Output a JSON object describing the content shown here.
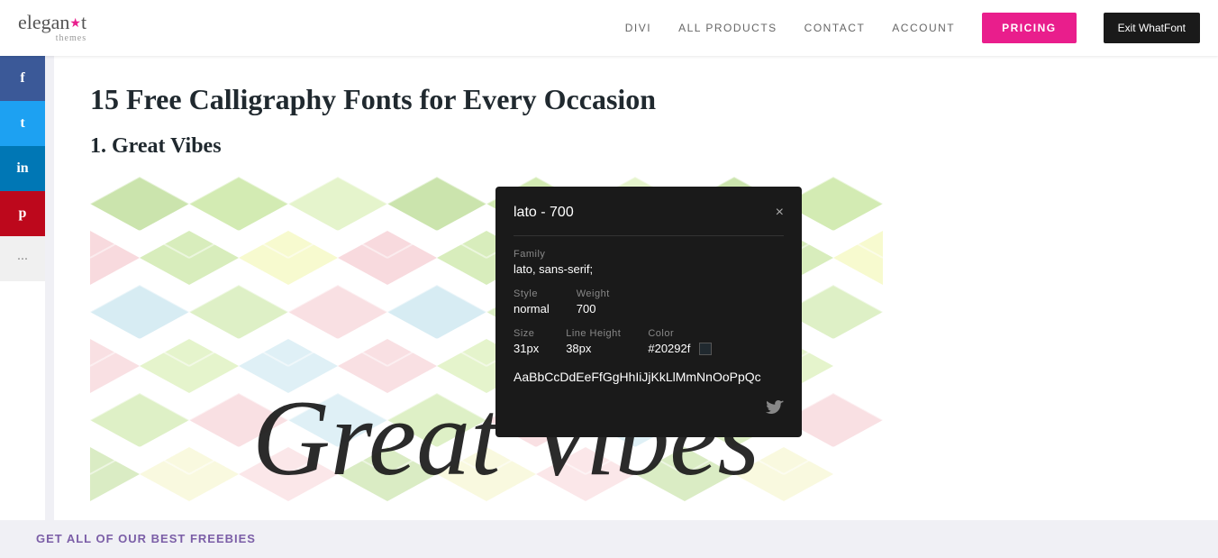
{
  "header": {
    "logo": {
      "main": "elegant",
      "star": "★",
      "sub": "themes"
    },
    "nav": {
      "items": [
        "DIVI",
        "ALL PRODUCTS",
        "CONTACT",
        "ACCOUNT"
      ],
      "pricing_label": "PRICING",
      "exit_whatfont_label": "Exit WhatFont"
    }
  },
  "article": {
    "title": "15 Free Calligraphy Fonts for Every Occasion",
    "section1_title": "1. Great Vibes",
    "font_image_text": "Great Vibes"
  },
  "whatfont_popup": {
    "title": "lato - 700",
    "close_label": "×",
    "family_label": "Family",
    "family_value": "lato, sans-serif;",
    "style_label": "Style",
    "style_value": "normal",
    "weight_label": "Weight",
    "weight_value": "700",
    "size_label": "Size",
    "size_value": "31px",
    "lineheight_label": "Line Height",
    "lineheight_value": "38px",
    "color_label": "Color",
    "color_value": "#20292f",
    "color_hex": "#20292f",
    "alphabet": "AaBbCcDdEeFfGgHhIiJjKkLlMmNnOoPpQc"
  },
  "social": {
    "items": [
      {
        "name": "facebook",
        "icon": "f"
      },
      {
        "name": "twitter",
        "icon": "t"
      },
      {
        "name": "linkedin",
        "icon": "in"
      },
      {
        "name": "pinterest",
        "icon": "p"
      },
      {
        "name": "more",
        "icon": "···"
      }
    ]
  },
  "freebies": {
    "link_text": "GET ALL OF OUR BEST FREEBIES"
  }
}
